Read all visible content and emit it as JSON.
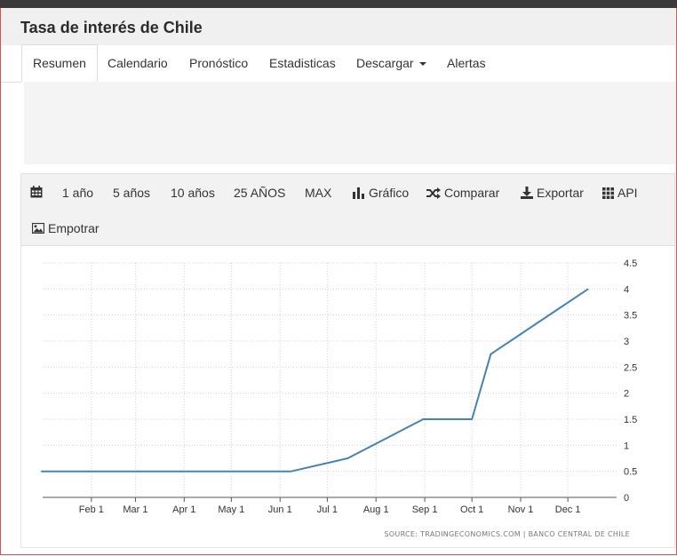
{
  "header": {
    "title": "Tasa de interés de Chile"
  },
  "tabs": [
    {
      "label": "Resumen",
      "active": true
    },
    {
      "label": "Calendario"
    },
    {
      "label": "Pronóstico"
    },
    {
      "label": "Estadisticas"
    },
    {
      "label": "Descargar"
    },
    {
      "label": "Alertas"
    }
  ],
  "toolbar": {
    "calendar_icon": "calendar-icon",
    "ranges": [
      "1 año",
      "5 años",
      "10 años",
      "25 AÑOS",
      "MAX"
    ],
    "grafico": "Gráfico",
    "comparar": "Comparar",
    "exportar": "Exportar",
    "api": "API",
    "empotrar": "Empotrar"
  },
  "chart_data": {
    "type": "line",
    "x_tick_labels": [
      "Feb 1",
      "Mar 1",
      "Apr 1",
      "May 1",
      "Jun 1",
      "Jul 1",
      "Aug 1",
      "Sep 1",
      "Oct 1",
      "Nov 1",
      "Dec 1"
    ],
    "x": [
      "2020-12-31",
      "2021-06-08",
      "2021-07-14",
      "2021-08-31",
      "2021-10-01",
      "2021-10-13",
      "2021-12-14"
    ],
    "series": [
      {
        "values": [
          0.5,
          0.5,
          0.75,
          1.5,
          1.5,
          2.75,
          4.0
        ],
        "color": "#4682b4"
      }
    ],
    "y_tick_labels": [
      "0",
      "0.5",
      "1",
      "1.5",
      "2",
      "2.5",
      "3",
      "3.5",
      "4",
      "4.5"
    ],
    "ylim": [
      0,
      4.5
    ],
    "grid": true,
    "y_axis_position": "right",
    "source": "SOURCE: TRADINGECONOMICS.COM | BANCO CENTRAL DE CHILE"
  }
}
